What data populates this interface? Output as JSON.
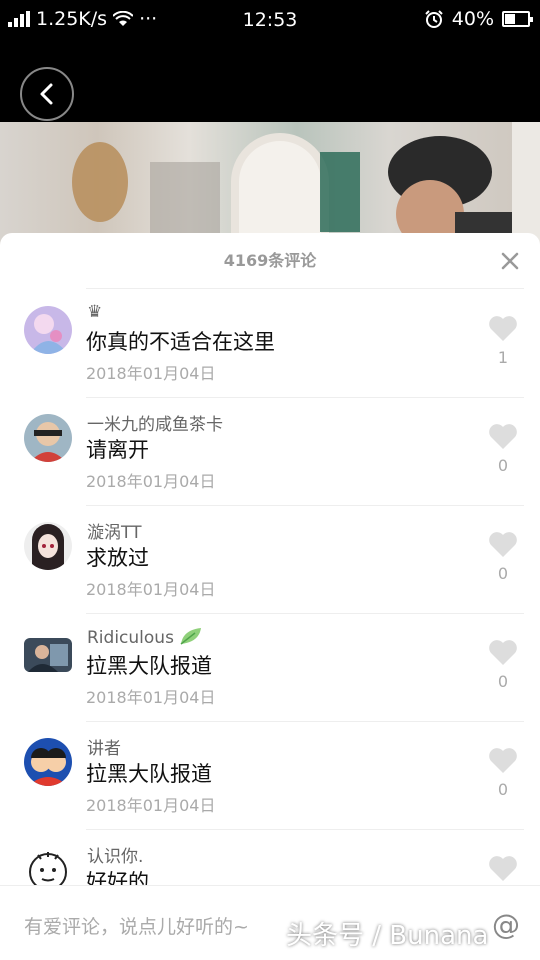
{
  "status_bar": {
    "network_speed": "1.25K/s",
    "more": "···",
    "time": "12:53",
    "battery_percent": "40%",
    "battery_level": 0.4
  },
  "sheet": {
    "title": "4169条评论"
  },
  "comments": [
    {
      "author": "♛",
      "content": "你真的不适合在这里",
      "date": "2018年01月04日",
      "likes": "1"
    },
    {
      "author": "一米九的咸鱼茶卡",
      "content": "请离开",
      "date": "2018年01月04日",
      "likes": "0"
    },
    {
      "author": "漩涡TT",
      "content": "求放过",
      "date": "2018年01月04日",
      "likes": "0"
    },
    {
      "author": "Ridiculous",
      "content": "拉黑大队报道",
      "date": "2018年01月04日",
      "likes": "0"
    },
    {
      "author": "讲者",
      "content": "拉黑大队报道",
      "date": "2018年01月04日",
      "likes": "0"
    },
    {
      "author": "认识你.",
      "content": "好好的",
      "date": "",
      "likes": ""
    }
  ],
  "input": {
    "placeholder": "有爱评论，说点儿好听的~",
    "mention": "@"
  },
  "watermark": "头条号 / Bunana"
}
